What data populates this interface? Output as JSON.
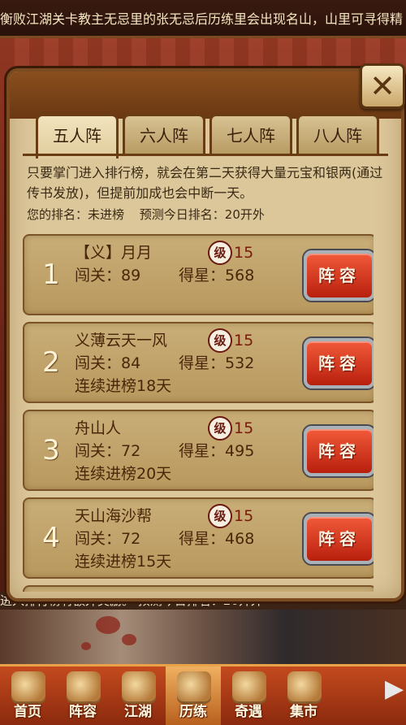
{
  "marquee": "衡败江湖关卡教主无忌里的张无忌后历练里会出现名山，山里可寻得精",
  "background_strip": "进入排行榜有额外奖励。     预测今日排名：20开外",
  "tabs": [
    {
      "label": "五人阵",
      "active": true
    },
    {
      "label": "六人阵",
      "active": false
    },
    {
      "label": "七人阵",
      "active": false
    },
    {
      "label": "八人阵",
      "active": false
    }
  ],
  "close_label": "✕",
  "intro_text": "只要掌门进入排行榜，就会在第二天获得大量元宝和银两(通过传书发放)，但提前加成也会中断一天。",
  "my_rank_label": "您的排名：未进榜",
  "predict_label": "预测今日排名：20开外",
  "level_badge": "级",
  "lineup_label": "阵容",
  "pass_prefix": "闯关：",
  "star_prefix": "得星：",
  "rows": [
    {
      "rank": "1",
      "name": "【义】月月",
      "level": "15",
      "pass": "89",
      "stars": "568",
      "streak": ""
    },
    {
      "rank": "2",
      "name": "义薄云天一风",
      "level": "15",
      "pass": "84",
      "stars": "532",
      "streak": "连续进榜18天"
    },
    {
      "rank": "3",
      "name": "舟山人",
      "level": "15",
      "pass": "72",
      "stars": "495",
      "streak": "连续进榜20天"
    },
    {
      "rank": "4",
      "name": "天山海沙帮",
      "level": "15",
      "pass": "72",
      "stars": "468",
      "streak": "连续进榜15天"
    }
  ],
  "nav": [
    {
      "label": "首页",
      "active": false
    },
    {
      "label": "阵容",
      "active": false
    },
    {
      "label": "江湖",
      "active": false
    },
    {
      "label": "历练",
      "active": true
    },
    {
      "label": "奇遇",
      "active": false
    },
    {
      "label": "集市",
      "active": false
    }
  ],
  "nav_more": "▶"
}
